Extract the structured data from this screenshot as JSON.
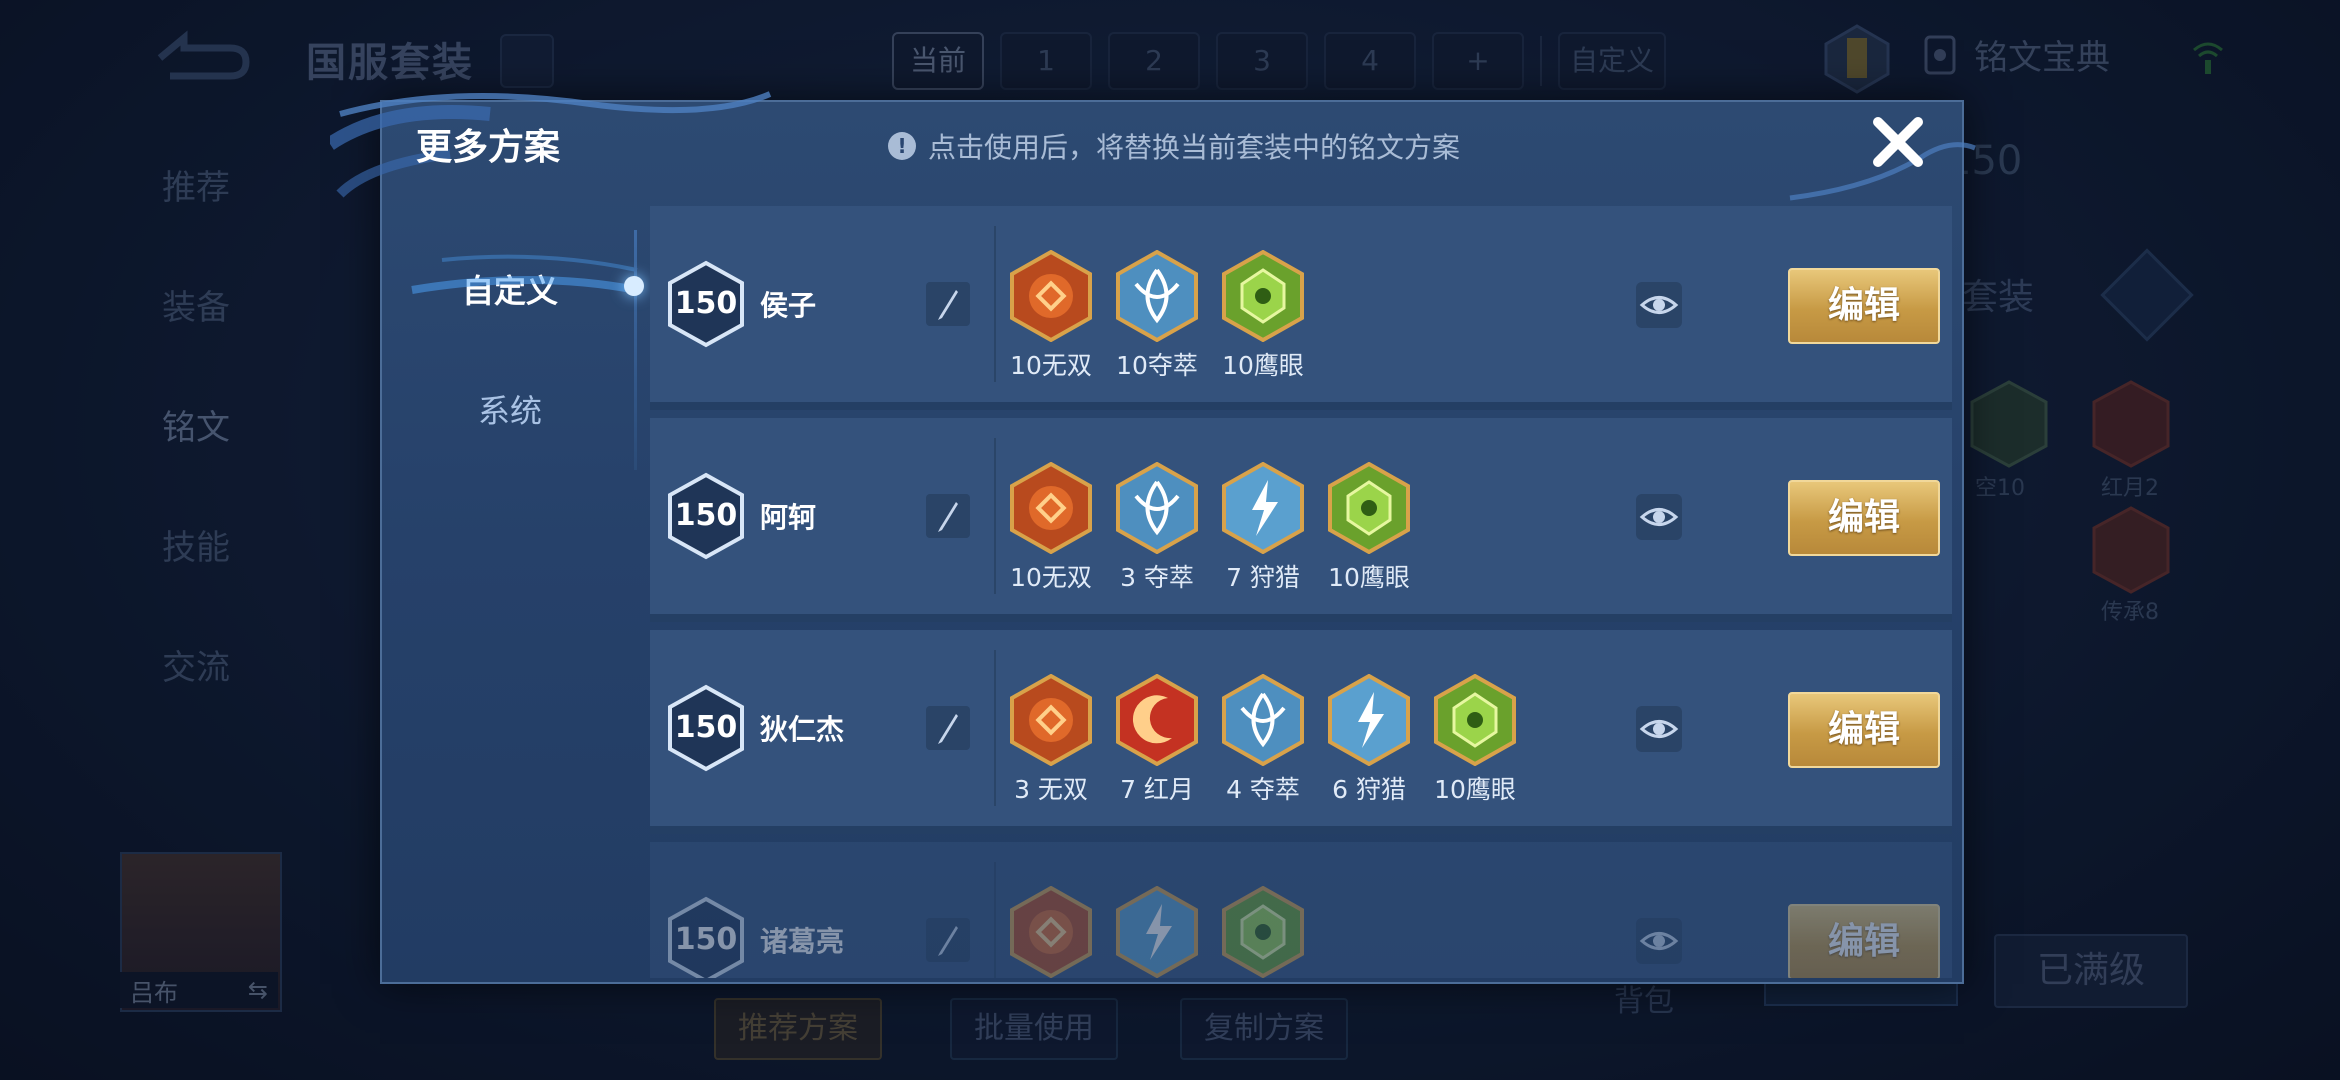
{
  "background": {
    "title": "国服套装",
    "tabs": [
      "当前",
      "1",
      "2",
      "3",
      "4",
      "+"
    ],
    "custom_tab": "自定义",
    "codex": "铭文宝典",
    "sidebar": [
      "推荐",
      "装备",
      "铭文",
      "技能",
      "交流"
    ],
    "badge_level": "150",
    "set_label": "套装",
    "runes": [
      {
        "label": "空10"
      },
      {
        "label": "红月2"
      },
      {
        "label": "传承8"
      }
    ],
    "hero_name": "吕布",
    "swap_icon": "⇆",
    "buttons": [
      "推荐方案",
      "批量使用",
      "复制方案"
    ],
    "bag": "背包",
    "max_level": "已满级"
  },
  "modal": {
    "title": "更多方案",
    "notice": "点击使用后，将替换当前套装中的铭文方案",
    "notice_icon": "!",
    "categories": {
      "custom": "自定义",
      "system": "系统"
    },
    "edit_label": "编辑",
    "rows": [
      {
        "level": "150",
        "name": "侯子",
        "runes": [
          {
            "type": "orange",
            "label": "10无双"
          },
          {
            "type": "blue",
            "label": "10夺萃"
          },
          {
            "type": "green",
            "label": "10鹰眼"
          }
        ]
      },
      {
        "level": "150",
        "name": "阿轲",
        "runes": [
          {
            "type": "orange",
            "label": "10无双"
          },
          {
            "type": "blue",
            "label": "3 夺萃"
          },
          {
            "type": "bolt",
            "label": "7 狩猎"
          },
          {
            "type": "green",
            "label": "10鹰眼"
          }
        ]
      },
      {
        "level": "150",
        "name": "狄仁杰",
        "runes": [
          {
            "type": "orange",
            "label": "3 无双"
          },
          {
            "type": "red",
            "label": "7 红月"
          },
          {
            "type": "blue",
            "label": "4 夺萃"
          },
          {
            "type": "bolt",
            "label": "6 狩猎"
          },
          {
            "type": "green",
            "label": "10鹰眼"
          }
        ]
      },
      {
        "level": "150",
        "name": "诸葛亮",
        "runes": [
          {
            "type": "orange",
            "label": ""
          },
          {
            "type": "bolt",
            "label": ""
          },
          {
            "type": "green",
            "label": ""
          }
        ]
      }
    ]
  },
  "colors": {
    "accent_gold": "#c79a45",
    "modal_bg": "#2d4a72",
    "row_bg": "#34527c"
  }
}
